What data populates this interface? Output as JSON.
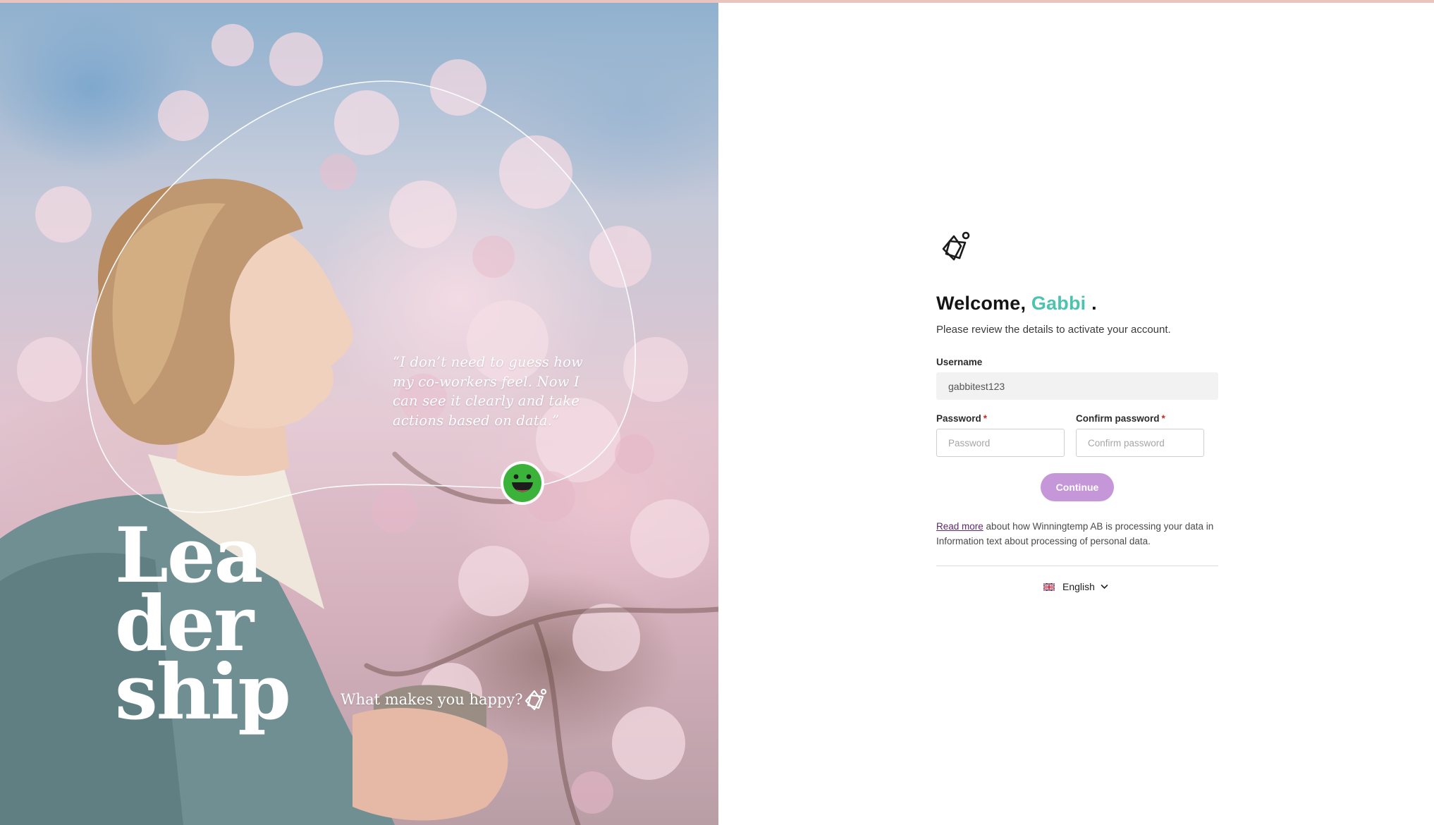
{
  "hero": {
    "quote": "“I don’t need to guess how my co-workers feel. Now I can see it clearly and take actions based on data.”",
    "headline_lines": [
      "Lea",
      "der",
      "ship"
    ],
    "tagline": "What makes you happy?"
  },
  "form": {
    "welcome_prefix": "Welcome, ",
    "welcome_name": "Gabbi",
    "welcome_suffix": " .",
    "subtitle": "Please review the details to activate your account.",
    "username_label": "Username",
    "username_value": "gabbitest123",
    "password_label": "Password",
    "password_placeholder": "Password",
    "confirm_label": "Confirm password",
    "confirm_placeholder": "Confirm password",
    "required_marker": "*",
    "continue_label": "Continue",
    "read_more": "Read more",
    "info_text": " about how Winningtemp AB is processing your data in Information text about processing of personal data.",
    "language": "English"
  },
  "colors": {
    "accent_name": "#4cc3ae",
    "button": "#c697d8",
    "link": "#5b2a6e"
  },
  "icons": {
    "brand": "winningtemp-logo-icon",
    "smiley": "happy-face-icon",
    "flag": "uk-flag-icon",
    "chevron": "chevron-down-icon"
  }
}
